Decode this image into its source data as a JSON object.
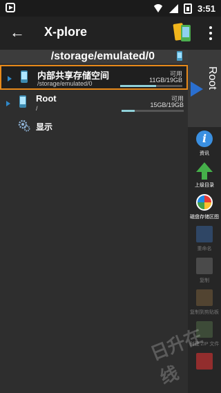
{
  "status": {
    "time": "3:51"
  },
  "appbar": {
    "title": "X-plore"
  },
  "pane": {
    "path": "/storage/emulated/0",
    "rows": [
      {
        "name": "内部共享存储空间",
        "sub": "/storage/emulated/0",
        "avail": "可用",
        "size": "11GB/19GB",
        "fill": 0.58
      },
      {
        "name": "Root",
        "sub": "/",
        "avail": "可用",
        "size": "15GB/19GB",
        "fill": 0.21
      }
    ],
    "display_label": "显示"
  },
  "right_pane": {
    "label": "Root"
  },
  "toolbar": [
    {
      "label": "资讯",
      "icon": "info-icon",
      "enabled": true
    },
    {
      "label": "上级目录",
      "icon": "up-arrow-icon",
      "enabled": true
    },
    {
      "label": "磁盘存储区图",
      "icon": "pie-chart-icon",
      "enabled": true
    },
    {
      "label": "重命名",
      "icon": "edit-icon",
      "enabled": false
    },
    {
      "label": "复制",
      "icon": "copy-icon",
      "enabled": false
    },
    {
      "label": "复制到剪贴板",
      "icon": "clipboard-icon",
      "enabled": false
    },
    {
      "label": "创建 ZIP 文件",
      "icon": "zip-icon",
      "enabled": false
    },
    {
      "label": "",
      "icon": "delete-icon",
      "enabled": false
    }
  ],
  "watermark": "日升在线"
}
